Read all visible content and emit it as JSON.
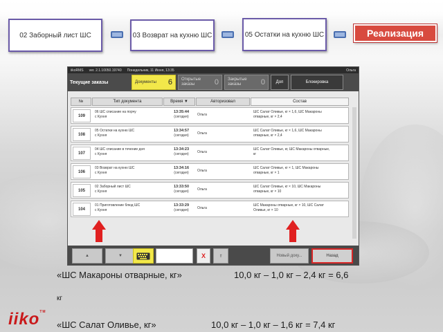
{
  "steps": [
    {
      "label": "02 Заборный лист ШС"
    },
    {
      "label": "03 Возврат на кухню ШС"
    },
    {
      "label": "05 Остатки на кухню ШС"
    }
  ],
  "sales_button": "Реализация",
  "app": {
    "titlebar": {
      "name": "iikoRMS",
      "version": "ver. 2.1.10050.19740",
      "date": "Понедельник, 11 Июня, 13:35",
      "user": "Ольга"
    },
    "header": {
      "title": "Текущие заказы",
      "tabs": [
        {
          "label": "Документы",
          "count": "6"
        },
        {
          "label": "Открытые заказы",
          "count": "0"
        },
        {
          "label": "Закрытые заказы",
          "count": "0"
        }
      ],
      "extra_button": "Доп",
      "lock_button": "Блокировка"
    },
    "columns": [
      "№",
      "Тип документа",
      "Время ▼",
      "Авторизовал",
      "Состав"
    ],
    "rows": [
      {
        "num": "109",
        "doc1": "06 ШС списание на порчу",
        "doc2": "с Кухня",
        "time": "13:35:44",
        "when": "(сегодня)",
        "author": "Ольга",
        "comp1": "ШС Салат Оливье, кг × 1,6, ШС Макароны",
        "comp2": "отварные, кг × 2,4"
      },
      {
        "num": "108",
        "doc1": "05 Остатки на кухню ШС",
        "doc2": "с Кухня",
        "time": "13:34:57",
        "when": "(сегодня)",
        "author": "Ольга",
        "comp1": "ШС Салат Оливье, кг × 1,6, ШС Макароны",
        "comp2": "отварные, кг × 2,4"
      },
      {
        "num": "107",
        "doc1": "04 ШС списание в течение дня",
        "doc2": "с Кухня",
        "time": "13:34:23",
        "when": "(сегодня)",
        "author": "Ольга",
        "comp1": "ШС Салат Оливье, кг, ШС Макароны отварные,",
        "comp2": "кг"
      },
      {
        "num": "106",
        "doc1": "03 Возврат на кухню ШС",
        "doc2": "с Кухня",
        "time": "13:34:16",
        "when": "(сегодня)",
        "author": "Ольга",
        "comp1": "ШС Салат Оливье, кг × 1, ШС Макароны",
        "comp2": "отварные, кг × 1"
      },
      {
        "num": "105",
        "doc1": "02 Заборный лист ШС",
        "doc2": "с Кухня",
        "time": "13:33:50",
        "when": "(сегодня)",
        "author": "Ольга",
        "comp1": "ШС Салат Оливье, кг × 10, ШС Макароны",
        "comp2": "отварные, кг × 10"
      },
      {
        "num": "104",
        "doc1": "01 Приготовление блюд ШС",
        "doc2": "с Кухня",
        "time": "13:33:29",
        "when": "(сегодня)",
        "author": "Ольга",
        "comp1": "ШС Макароны отварные, кг × 10, ШС Салат",
        "comp2": "Оливье, кг × 10"
      }
    ],
    "bottom": {
      "up": "▲",
      "down": "▼",
      "clear": "X",
      "top": "⇑",
      "new_doc": "Новый доку...",
      "back": "Назад"
    }
  },
  "formula": {
    "line1_left": "«ШС Макароны отварные, кг»",
    "line1_right": "10,0 кг – 1,0 кг – 2,4 кг = 6,6",
    "line1_unit": "кг",
    "line2_left": "«ШС Салат Оливье, кг»",
    "line2_right": "10,0 кг – 1,0 кг – 1,6 кг = 7,4 кг"
  },
  "logo": {
    "text": "iiko",
    "tm": "TM"
  }
}
